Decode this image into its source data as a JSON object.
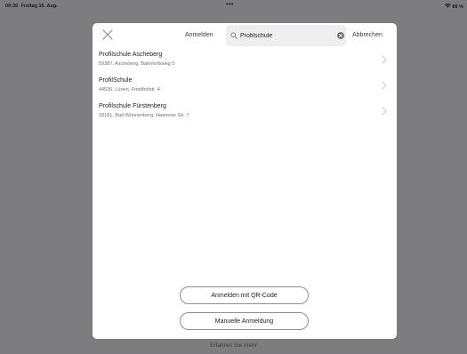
{
  "status_bar": {
    "time": "09:39",
    "date": "Freitag 16. Aug.",
    "dots": "•••",
    "battery": "89 %"
  },
  "background": {
    "footer_link": "Erfahren Sie mehr"
  },
  "sheet": {
    "title": "Anmelden",
    "search": {
      "value": "Profilschule"
    },
    "cancel_label": "Abbrechen",
    "results": [
      {
        "name": "Profilschule Ascheberg",
        "address": "59387, Ascheberg, Bahnhofsweg 5"
      },
      {
        "name": "ProfilSchule",
        "address": "44536, Lünen, Friedhofstr. 4"
      },
      {
        "name": "Profilschule Fürstenberg",
        "address": "33181, Bad Wünnenberg, Haarener Str. 7"
      }
    ],
    "qr_button_label": "Anmelden mit QR-Code",
    "manual_button_label": "Manuelle Anmeldung"
  },
  "colors": {
    "backdrop": "#7d7d7f",
    "sheet": "#ffffff",
    "chevron": "#c7c7cc"
  }
}
